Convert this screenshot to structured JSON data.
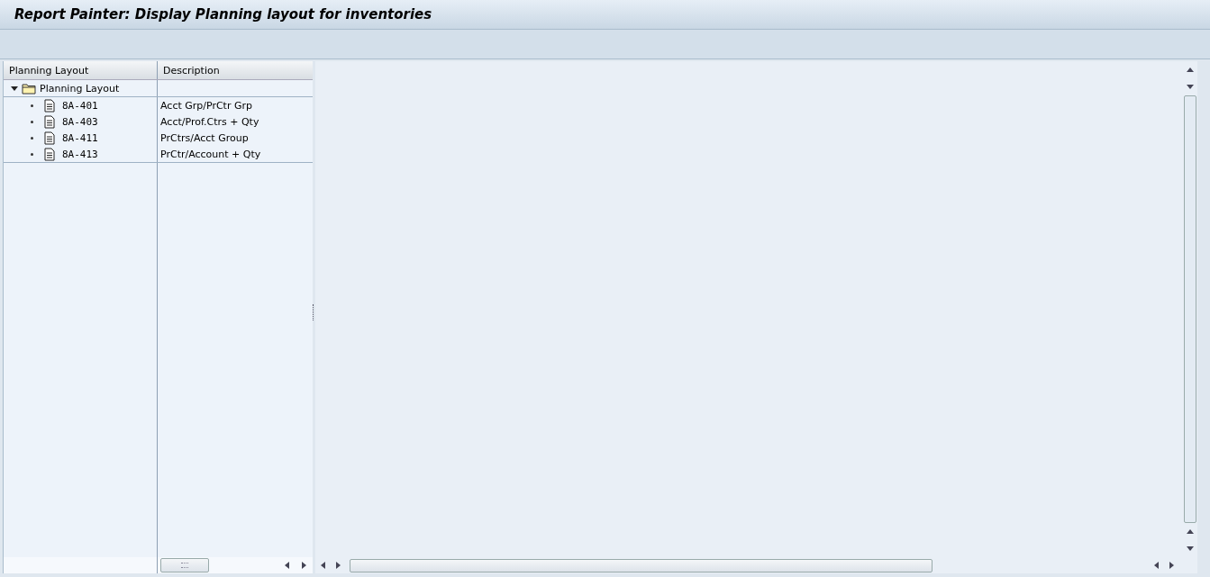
{
  "window": {
    "title": "Report Painter: Display Planning layout for inventories"
  },
  "tree": {
    "columns": [
      "Planning Layout",
      "Description"
    ],
    "root": {
      "label": "Planning Layout",
      "expanded": true,
      "children": [
        {
          "name": "8A-401",
          "description": "Acct Grp/PrCtr Grp"
        },
        {
          "name": "8A-403",
          "description": "Acct/Prof.Ctrs + Qty"
        },
        {
          "name": "8A-411",
          "description": "PrCtrs/Acct Group"
        },
        {
          "name": "8A-413",
          "description": "PrCtr/Account + Qty"
        }
      ]
    }
  }
}
